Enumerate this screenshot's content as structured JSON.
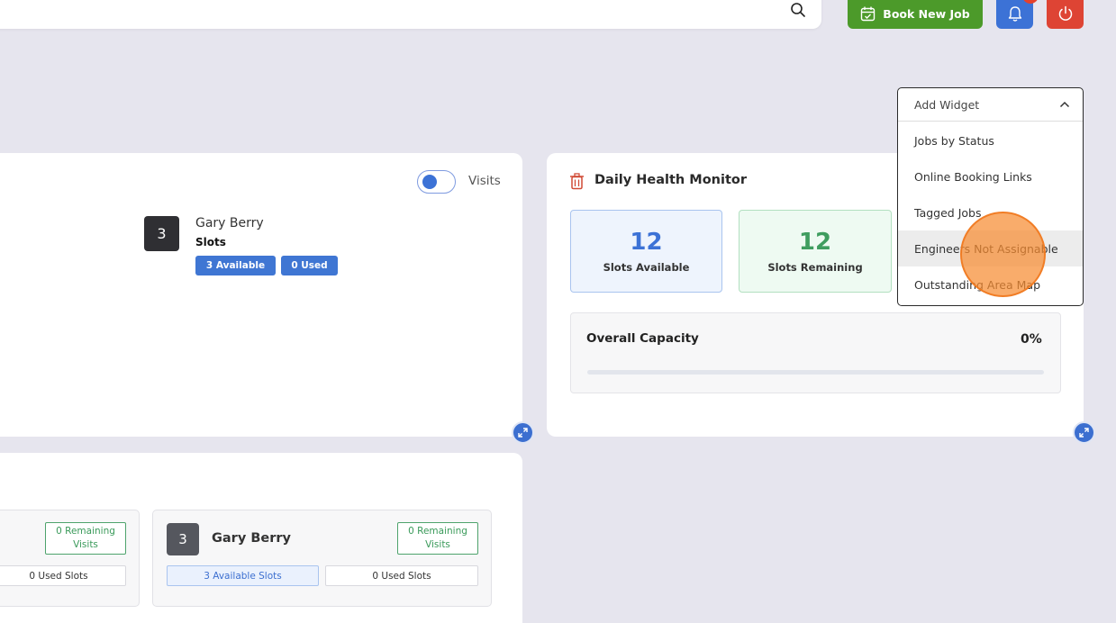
{
  "header": {
    "book_new_job_label": "Book New Job"
  },
  "slots_widget": {
    "toggle_label": "Visits",
    "engineer": {
      "number": "3",
      "name": "Gary Berry",
      "subtitle": "Slots",
      "available_pill": "3 Available",
      "used_pill": "0 Used"
    }
  },
  "daily_health_monitor": {
    "title": "Daily Health Monitor",
    "stats": [
      {
        "value": "12",
        "label": "Slots Available",
        "color": "#3c72d6"
      },
      {
        "value": "12",
        "label": "Slots Remaining",
        "color": "#3f9d5f"
      }
    ],
    "overall_capacity": {
      "label": "Overall Capacity",
      "percent_text": "0%",
      "value": 0
    }
  },
  "visits_widget": {
    "left_panel": {
      "remaining_badge": "0 Remaining\nVisits",
      "used_slots": "0 Used Slots"
    },
    "right_panel": {
      "number": "3",
      "name": "Gary Berry",
      "remaining_badge": "0 Remaining\nVisits",
      "available_slots": "3 Available Slots",
      "used_slots": "0 Used Slots"
    }
  },
  "add_widget_dropdown": {
    "header_label": "Add Widget",
    "items": [
      {
        "label": "Jobs by Status"
      },
      {
        "label": "Online Booking Links"
      },
      {
        "label": "Tagged Jobs"
      },
      {
        "label": "Engineers Not Assignable"
      },
      {
        "label": "Outstanding Area Map"
      }
    ]
  },
  "colors": {
    "background": "#e6e5ee",
    "primary_blue": "#3c72d6",
    "book_green": "#4c9a2a",
    "power_red": "#de4434",
    "cursor_orange": "#f68c32"
  }
}
